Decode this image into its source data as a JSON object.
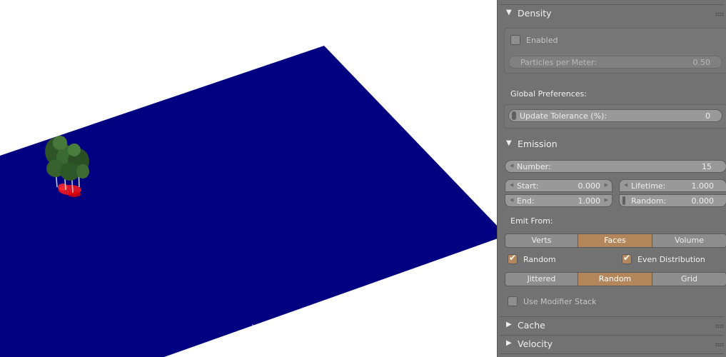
{
  "panel": {
    "density": {
      "header": "Density",
      "enabled_label": "Enabled",
      "enabled": false,
      "particles_label": "Particles per Meter:",
      "particles_value": "0.50",
      "global_prefs_label": "Global Preferences:",
      "update_tolerance_label": "Update Tolerance (%):",
      "update_tolerance_value": "0"
    },
    "emission": {
      "header": "Emission",
      "number_label": "Number:",
      "number_value": "15",
      "start_label": "Start:",
      "start_value": "0.000",
      "end_label": "End:",
      "end_value": "1.000",
      "lifetime_label": "Lifetime:",
      "lifetime_value": "1.000",
      "random_label": "Random:",
      "random_value": "0.000",
      "emit_from_label": "Emit From:",
      "emit_from_options": [
        "Verts",
        "Faces",
        "Volume"
      ],
      "emit_from_selected": "Faces",
      "random_check_label": "Random",
      "random_checked": true,
      "even_dist_label": "Even Distribution",
      "even_dist_checked": true,
      "distribution_options": [
        "Jittered",
        "Random",
        "Grid"
      ],
      "distribution_selected": "Random",
      "modifier_stack_label": "Use Modifier Stack",
      "modifier_stack_checked": false
    },
    "cache": {
      "header": "Cache"
    },
    "velocity": {
      "header": "Velocity"
    }
  },
  "icons": {
    "expanded": "triangle-down-icon",
    "collapsed": "triangle-right-icon",
    "drag": "drag-grip-icon",
    "check": "checkmark-icon"
  },
  "colors": {
    "ground_plane": "#000080",
    "emitter_highlight": "#ff0000",
    "foliage": "#2f5a2a",
    "selected_toggle": "#b3875b",
    "panel_bg": "#727272"
  }
}
